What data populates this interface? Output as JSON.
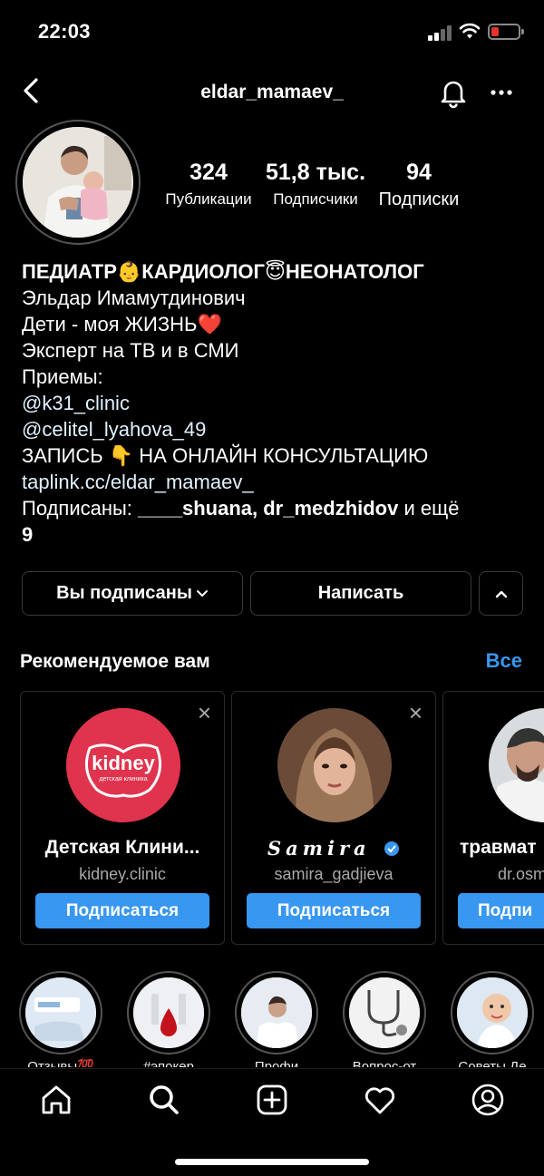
{
  "status_bar": {
    "time": "22:03",
    "battery_color": "#e5342e"
  },
  "header": {
    "username": "eldar_mamaev_"
  },
  "stats": [
    {
      "value": "324",
      "label": "Публикации"
    },
    {
      "value": "51,8 тыс.",
      "label": "Подписчики"
    },
    {
      "value": "94",
      "label": "Подписки"
    }
  ],
  "bio": {
    "name_line": "ПЕДИАТР👶КАРДИОЛОГ😇НЕОНАТОЛОГ",
    "line1": "Эльдар Имамутдинович",
    "line2": "Дети - моя ЖИЗНЬ❤️",
    "line3": "Эксперт на ТВ и в СМИ",
    "line4": "Приемы:",
    "line5": "@k31_clinic",
    "line6": "@celitel_lyahova_49",
    "line7": "ЗАПИСЬ 👇 НА ОНЛАЙН КОНСУЛЬТАЦИЮ",
    "link": "taplink.cc/eldar_mamaev_",
    "followed_prefix": "Подписаны: ",
    "followed_users": "____shuana, dr_medzhidov",
    "followed_suffix": " и ещё",
    "followed_count": "9"
  },
  "buttons": {
    "following": "Вы подписаны",
    "message": "Написать"
  },
  "suggested": {
    "title": "Рекомендуемое вам",
    "see_all": "Все",
    "accent_color": "#3897f0",
    "cards": [
      {
        "name": "Детская Клини...",
        "handle": "kidney.clinic",
        "follow": "Подписаться",
        "logo_text": "kidney",
        "logo_sub": "детская клиника"
      },
      {
        "name": "Samira",
        "handle": "samira_gadjieva",
        "follow": "Подписаться"
      },
      {
        "name": "травмат",
        "handle": "dr.osm",
        "follow": "Подпи"
      }
    ]
  },
  "highlights": [
    {
      "label": "Отзывы💯"
    },
    {
      "label": "#эпокер"
    },
    {
      "label": "Профи"
    },
    {
      "label": "Вопрос-от"
    },
    {
      "label": "Советы Де"
    }
  ],
  "tabs": [
    "home-icon",
    "search-icon",
    "new-post-icon",
    "activity-heart-icon",
    "profile-icon"
  ]
}
